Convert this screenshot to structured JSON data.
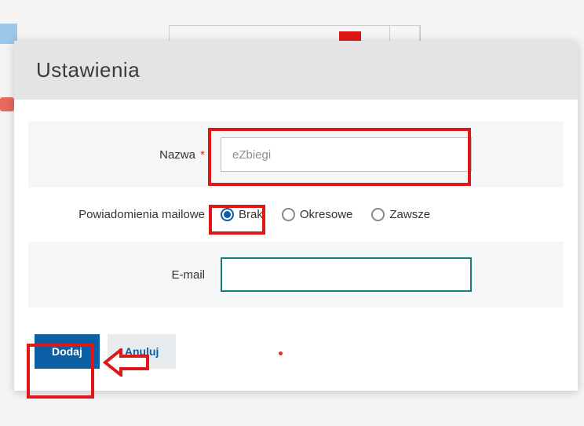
{
  "modal": {
    "title": "Ustawienia",
    "name_field": {
      "label": "Nazwa",
      "required_mark": "*",
      "placeholder": "eZbiegi",
      "value": ""
    },
    "notifications": {
      "label": "Powiadomienia mailowe",
      "options": {
        "none": "Brak",
        "periodic": "Okresowe",
        "always": "Zawsze"
      },
      "selected": "none"
    },
    "email_field": {
      "label": "E-mail",
      "value": ""
    },
    "actions": {
      "submit": "Dodaj",
      "cancel": "Anuluj"
    }
  }
}
